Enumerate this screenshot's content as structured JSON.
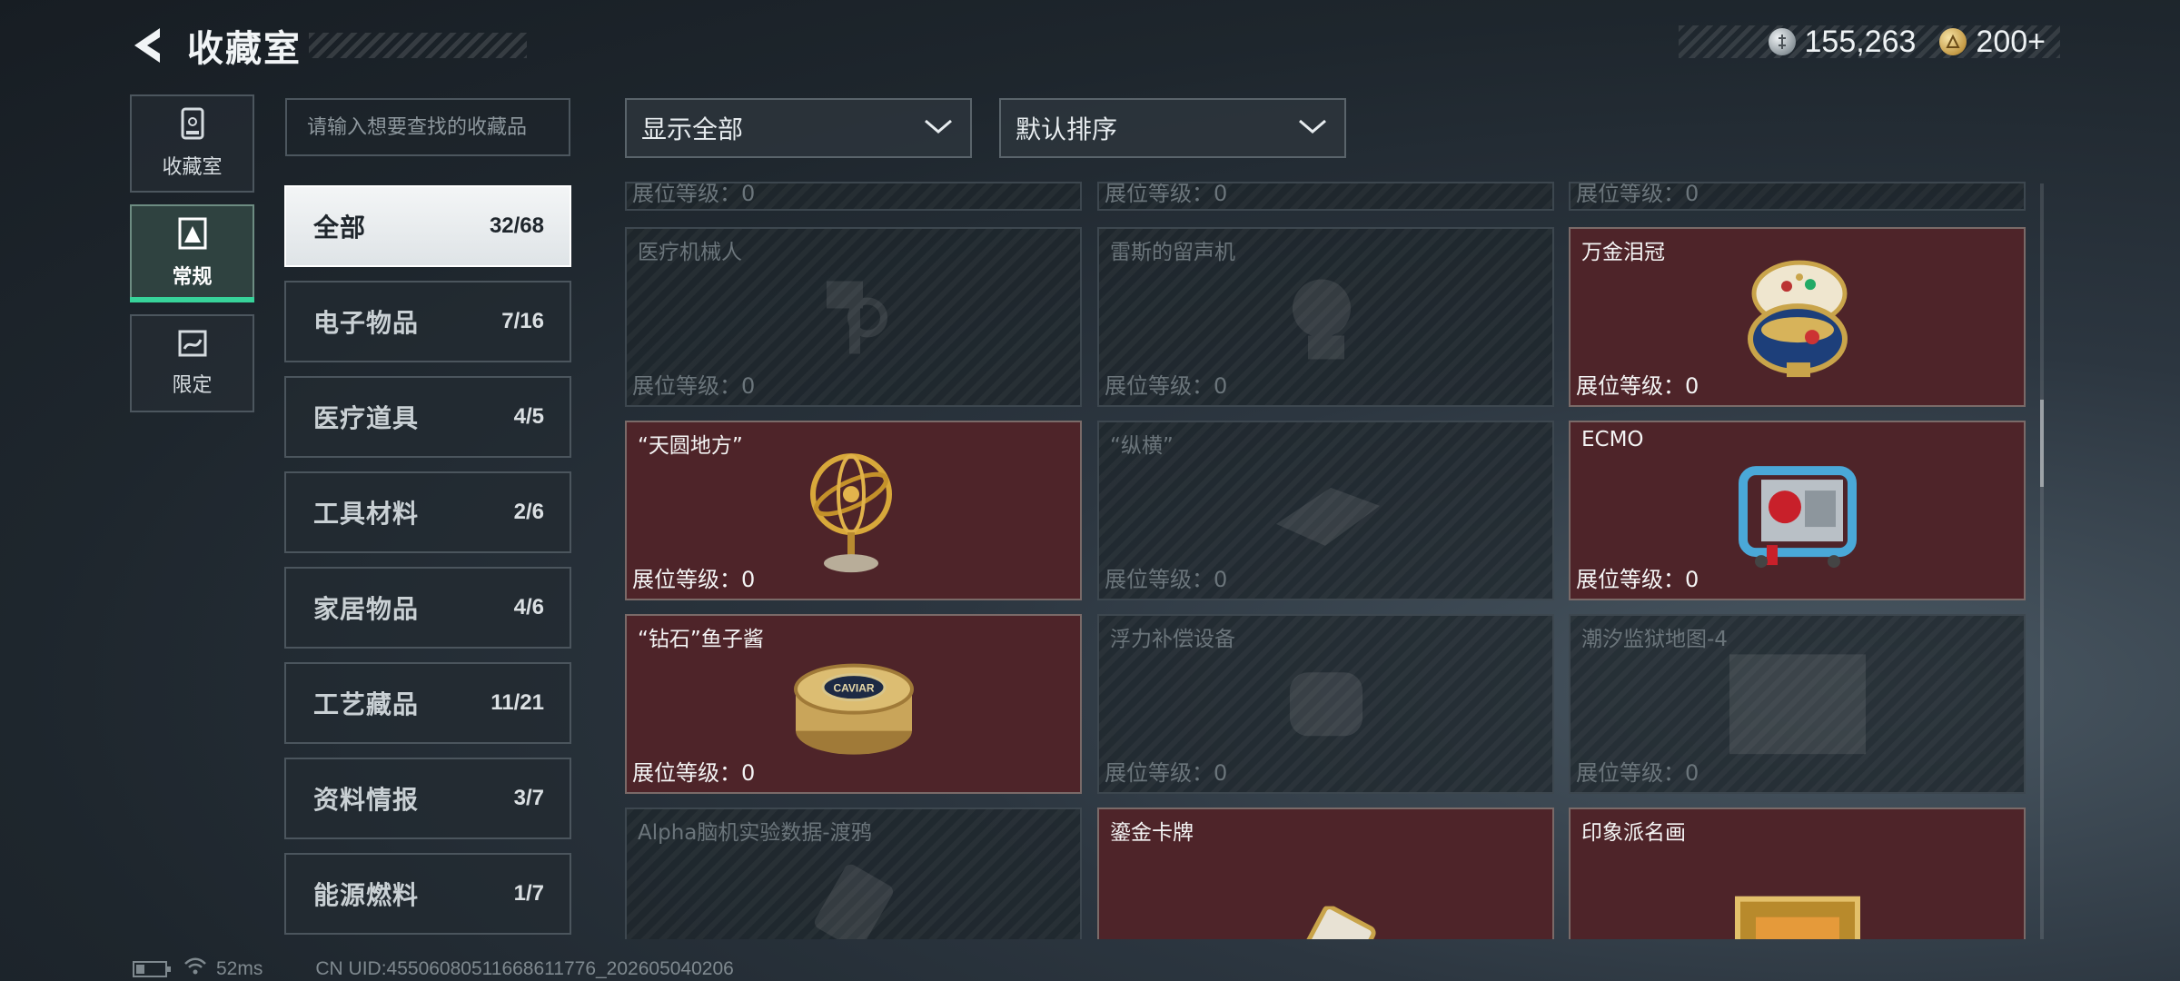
{
  "header": {
    "title": "收藏室"
  },
  "currency": {
    "silver": "155,263",
    "gold": "200+"
  },
  "leftnav": [
    {
      "label": "收藏室",
      "icon": "collection-room-icon",
      "active": false
    },
    {
      "label": "常规",
      "icon": "regular-icon",
      "active": true
    },
    {
      "label": "限定",
      "icon": "limited-icon",
      "active": false
    }
  ],
  "search": {
    "placeholder": "请输入想要查找的收藏品"
  },
  "categories": [
    {
      "name": "全部",
      "count": "32/68",
      "active": true
    },
    {
      "name": "电子物品",
      "count": "7/16"
    },
    {
      "name": "医疗道具",
      "count": "4/5"
    },
    {
      "name": "工具材料",
      "count": "2/6"
    },
    {
      "name": "家居物品",
      "count": "4/6"
    },
    {
      "name": "工艺藏品",
      "count": "11/21"
    },
    {
      "name": "资料情报",
      "count": "3/7"
    },
    {
      "name": "能源燃料",
      "count": "1/7"
    }
  ],
  "filters": {
    "display": "显示全部",
    "sort": "默认排序"
  },
  "items": [
    {
      "name": "",
      "level": "展位等级：0",
      "owned": false,
      "art": ""
    },
    {
      "name": "",
      "level": "展位等级：0",
      "owned": false,
      "art": ""
    },
    {
      "name": "",
      "level": "展位等级：0",
      "owned": false,
      "art": ""
    },
    {
      "name": "医疗机械人",
      "level": "展位等级：0",
      "owned": false,
      "art": "robot-icon"
    },
    {
      "name": "雷斯的留声机",
      "level": "展位等级：0",
      "owned": false,
      "art": "phonograph-icon"
    },
    {
      "name": "万金泪冠",
      "level": "展位等级：0",
      "owned": true,
      "art": "jeweled-egg-icon"
    },
    {
      "name": "“天圆地方”",
      "level": "展位等级：0",
      "owned": true,
      "art": "armillary-sphere-icon"
    },
    {
      "name": "“纵横”",
      "level": "展位等级：0",
      "owned": false,
      "art": "chessboard-icon"
    },
    {
      "name": "ECMO",
      "level": "展位等级：0",
      "owned": true,
      "art": "ecmo-machine-icon"
    },
    {
      "name": "“钻石”鱼子酱",
      "level": "展位等级：0",
      "owned": true,
      "art": "caviar-tin-icon"
    },
    {
      "name": "浮力补偿设备",
      "level": "展位等级：0",
      "owned": false,
      "art": "buoyancy-device-icon"
    },
    {
      "name": "潮汐监狱地图-4",
      "level": "展位等级：0",
      "owned": false,
      "art": "map-icon"
    },
    {
      "name": "Alpha脑机实验数据-渡鸦",
      "level": "",
      "owned": false,
      "art": "data-drive-icon"
    },
    {
      "name": "鎏金卡牌",
      "level": "",
      "owned": true,
      "art": "gilded-card-icon"
    },
    {
      "name": "印象派名画",
      "level": "",
      "owned": true,
      "art": "framed-painting-icon"
    }
  ],
  "caviar_label": "CAVIAR",
  "footer": {
    "ping": "52ms",
    "uid": "CN UID:455060805116686117​76_202605040206"
  }
}
